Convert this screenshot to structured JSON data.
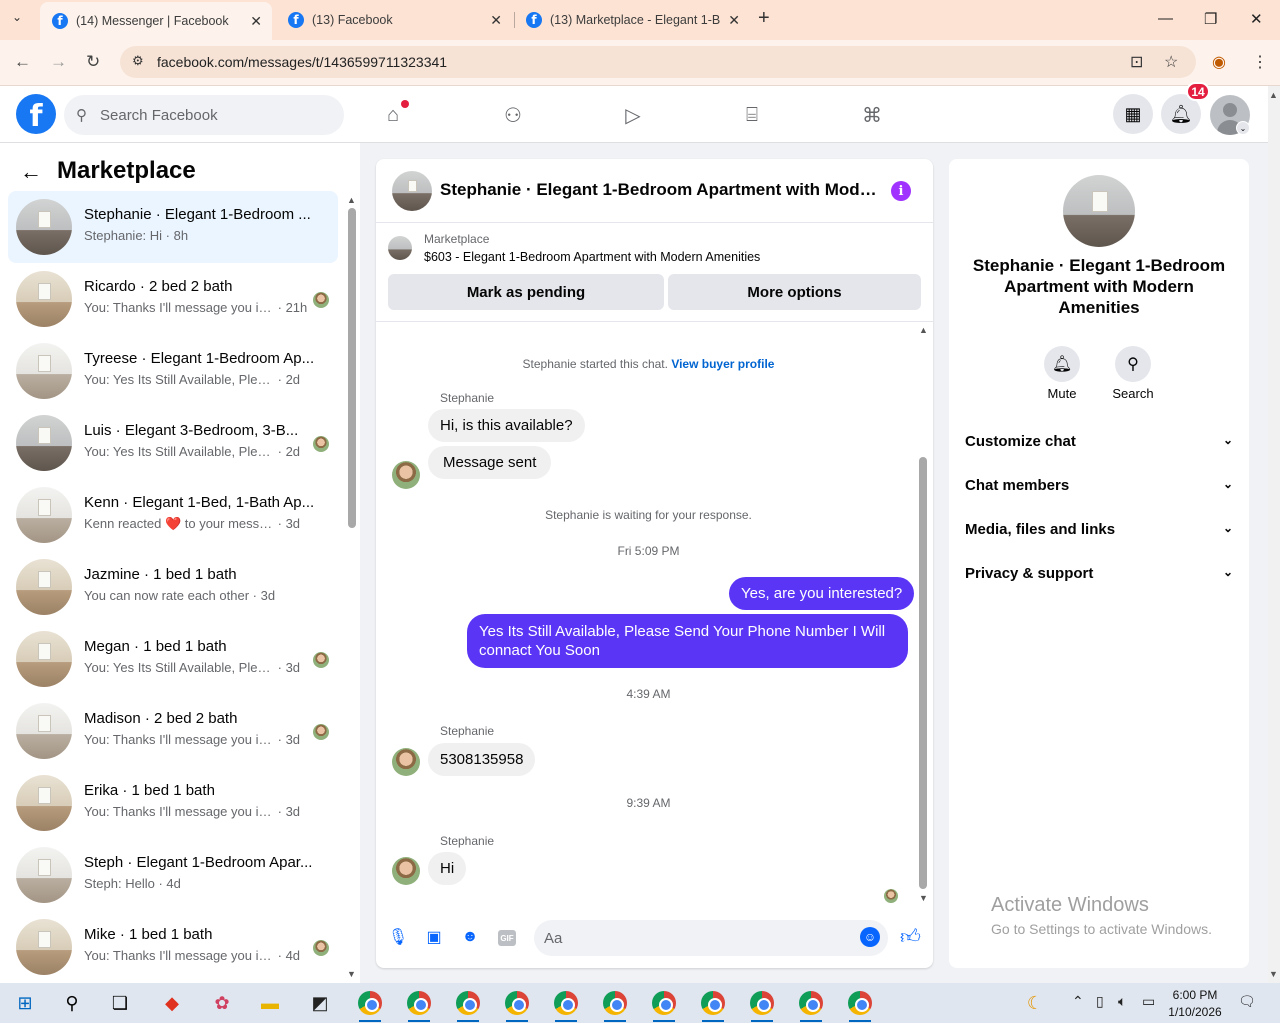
{
  "browser": {
    "tabs": [
      {
        "title": "(14) Messenger | Facebook",
        "active": true
      },
      {
        "title": "(13) Facebook",
        "active": false
      },
      {
        "title": "(13) Marketplace - Elegant 1-Be",
        "active": false
      }
    ],
    "url": "facebook.com/messages/t/1436599711323341",
    "new_tab_glyph": "+"
  },
  "fb_nav": {
    "search_placeholder": "Search Facebook",
    "notification_count": "14",
    "icons": [
      "home-icon",
      "friends-icon",
      "watch-icon",
      "marketplace-icon",
      "gaming-icon",
      "menu-grid-icon",
      "bell-icon",
      "profile-avatar"
    ]
  },
  "sidebar": {
    "title": "Marketplace",
    "conversations": [
      {
        "name": "Stephanie · Elegant 1-Bedroom ...",
        "preview": "Stephanie: Hi",
        "time": "8h",
        "photo": "grey",
        "seen": false,
        "active": true
      },
      {
        "name": "Ricardo · 2 bed 2 bath",
        "preview": "You: Thanks I'll message you in...",
        "time": "21h",
        "photo": "warm",
        "seen": true
      },
      {
        "name": "Tyreese · Elegant 1-Bedroom Ap...",
        "preview": "You: Yes Its Still Available, Please Se...",
        "time": "2d",
        "photo": "white",
        "seen": false
      },
      {
        "name": "Luis · Elegant 3-Bedroom, 3-B...",
        "preview": "You: Yes Its Still Available, Please...",
        "time": "2d",
        "photo": "grey",
        "seen": true
      },
      {
        "name": "Kenn · Elegant 1-Bed, 1-Bath Ap...",
        "preview": "Kenn reacted ❤️ to your message",
        "time": "3d",
        "photo": "white",
        "seen": false
      },
      {
        "name": "Jazmine · 1 bed 1 bath",
        "preview": "You can now rate each other",
        "time": "3d",
        "photo": "warm",
        "seen": false
      },
      {
        "name": "Megan · 1 bed 1 bath",
        "preview": "You: Yes Its Still Available, Please...",
        "time": "3d",
        "photo": "warm",
        "seen": true
      },
      {
        "name": "Madison · 2 bed 2 bath",
        "preview": "You: Thanks I'll message you in ...",
        "time": "3d",
        "photo": "white",
        "seen": true
      },
      {
        "name": "Erika · 1 bed 1 bath",
        "preview": "You: Thanks I'll message you in a m...",
        "time": "3d",
        "photo": "warm",
        "seen": false
      },
      {
        "name": "Steph · Elegant 1-Bedroom Apar...",
        "preview": "Steph: Hello",
        "time": "4d",
        "photo": "white",
        "seen": false
      },
      {
        "name": "Mike · 1 bed 1 bath",
        "preview": "You: Thanks I'll message you in ...",
        "time": "4d",
        "photo": "warm",
        "seen": true
      }
    ]
  },
  "chat": {
    "title": "Stephanie · Elegant 1-Bedroom Apartment with Moder...",
    "marketplace_label": "Marketplace",
    "listing": "$603 - Elegant 1-Bedroom Apartment with Modern Amenities",
    "mark_pending": "Mark as pending",
    "more_options": "More options",
    "started_text": "Stephanie started this chat.",
    "view_buyer": "View buyer profile",
    "sender_name": "Stephanie",
    "msg1": "Hi, is this available?",
    "msg2": "Message sent",
    "waiting": "Stephanie is waiting for your response.",
    "time1": "Fri 5:09 PM",
    "out1": "Yes, are you interested?",
    "out2": "Yes Its Still Available, Please Send Your Phone Number I Will connact You Soon",
    "time2": "4:39 AM",
    "msg3": "5308135958",
    "time3": "9:39 AM",
    "msg4": "Hi",
    "composer_placeholder": "Aa"
  },
  "details": {
    "name": "Stephanie · Elegant 1-Bedroom Apartment with Modern Amenities",
    "mute": "Mute",
    "search": "Search",
    "rows": [
      "Customize chat",
      "Chat members",
      "Media, files and links",
      "Privacy & support"
    ]
  },
  "watermark": {
    "line1": "Activate Windows",
    "line2": "Go to Settings to activate Windows."
  },
  "taskbar": {
    "time": "6:00 PM",
    "date": "1/10/2026"
  },
  "colors": {
    "fb_blue": "#1877f2",
    "outgoing_bubble": "#5b35f5",
    "notification_red": "#e41e3f",
    "info_purple": "#a033ff"
  }
}
